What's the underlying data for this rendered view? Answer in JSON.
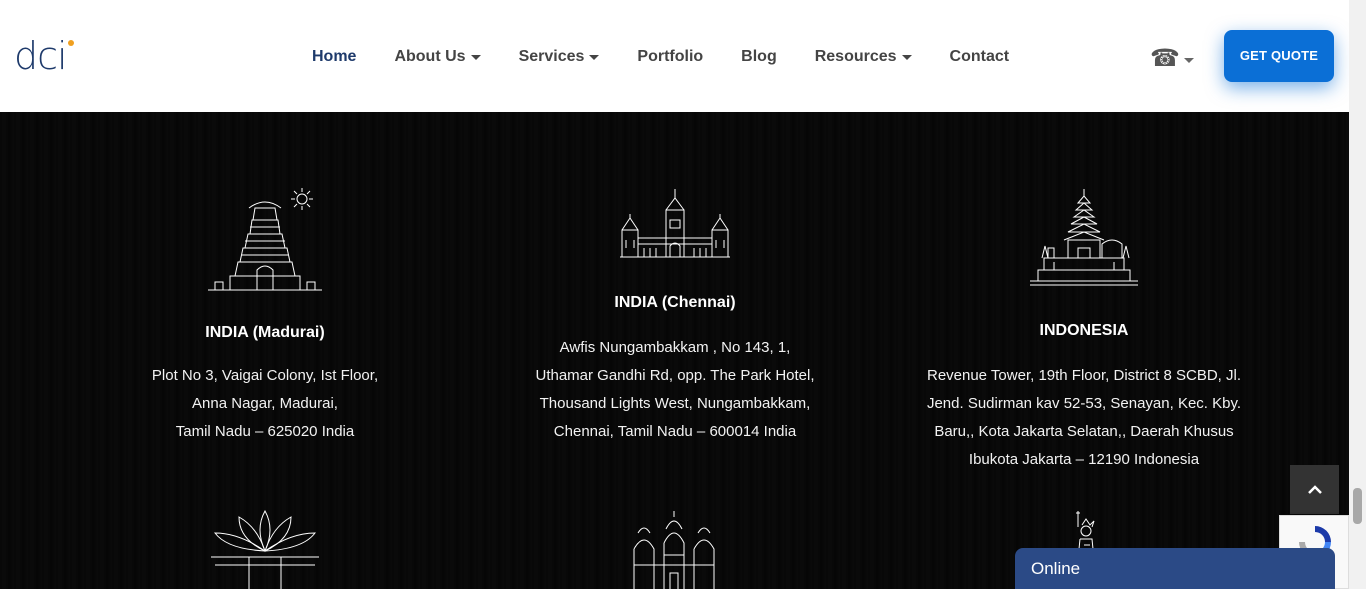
{
  "header": {
    "logo_text": "dci",
    "nav": [
      {
        "label": "Home",
        "active": true,
        "dropdown": false
      },
      {
        "label": "About Us",
        "active": false,
        "dropdown": true
      },
      {
        "label": "Services",
        "active": false,
        "dropdown": true
      },
      {
        "label": "Portfolio",
        "active": false,
        "dropdown": false
      },
      {
        "label": "Blog",
        "active": false,
        "dropdown": false
      },
      {
        "label": "Resources",
        "active": false,
        "dropdown": true
      },
      {
        "label": "Contact",
        "active": false,
        "dropdown": false
      }
    ],
    "phone_icon": "phone-icon",
    "quote_label": "GET QUOTE"
  },
  "offices": [
    {
      "title": "INDIA (Madurai)",
      "address": [
        "Plot No 3, Vaigai Colony, Ist Floor,",
        "Anna Nagar, Madurai,",
        "Tamil Nadu – 625020 India"
      ],
      "icon": "temple-icon"
    },
    {
      "title": "INDIA (Chennai)",
      "address": [
        "Awfis Nungambakkam , No 143, 1,",
        "Uthamar Gandhi Rd, opp. The Park Hotel,",
        "Thousand Lights West, Nungambakkam,",
        "Chennai, Tamil Nadu – 600014 India"
      ],
      "icon": "high-court-icon"
    },
    {
      "title": "INDONESIA",
      "address": [
        "Revenue Tower, 19th Floor, District 8 SCBD, Jl.",
        "Jend. Sudirman kav 52-53, Senayan, Kec. Kby.",
        "Baru,, Kota Jakarta Selatan,, Daerah Khusus",
        "Ibukota Jakarta – 12190 Indonesia"
      ],
      "icon": "pagoda-icon"
    }
  ],
  "lower_icons": [
    "lotus-temple-icon",
    "angkor-wat-icon",
    "statue-of-liberty-icon"
  ],
  "chat": {
    "label": "Online"
  },
  "colors": {
    "brand": "#1e3a6b",
    "accent": "#0b6fd6",
    "chat": "#2b4a86"
  }
}
